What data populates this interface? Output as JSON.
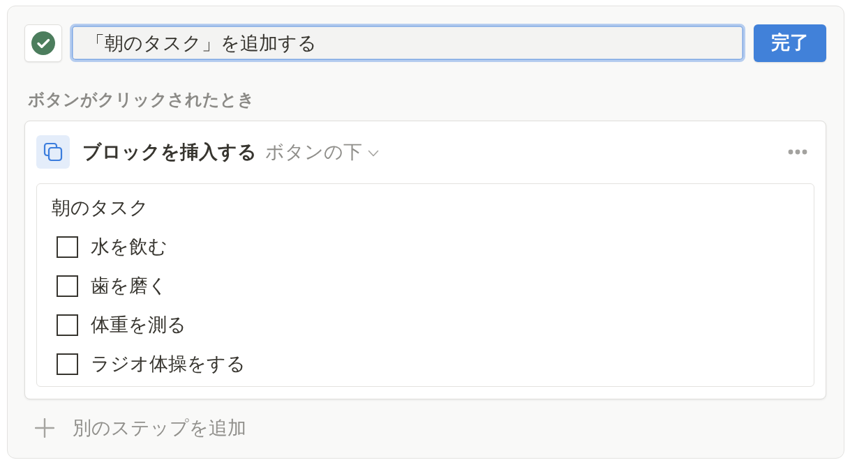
{
  "editor": {
    "name_input": {
      "value": "「朝のタスク」を追加する"
    },
    "done_button": "完了"
  },
  "trigger_label": "ボタンがクリックされたとき",
  "steps": [
    {
      "action": "ブロックを挿入する",
      "position": "ボタンの下",
      "block": {
        "title": "朝のタスク",
        "todos": [
          {
            "label": "水を飲む",
            "checked": false
          },
          {
            "label": "歯を磨く",
            "checked": false
          },
          {
            "label": "体重を測る",
            "checked": false
          },
          {
            "label": "ラジオ体操をする",
            "checked": false
          }
        ]
      }
    }
  ],
  "add_step": "別のステップを追加"
}
